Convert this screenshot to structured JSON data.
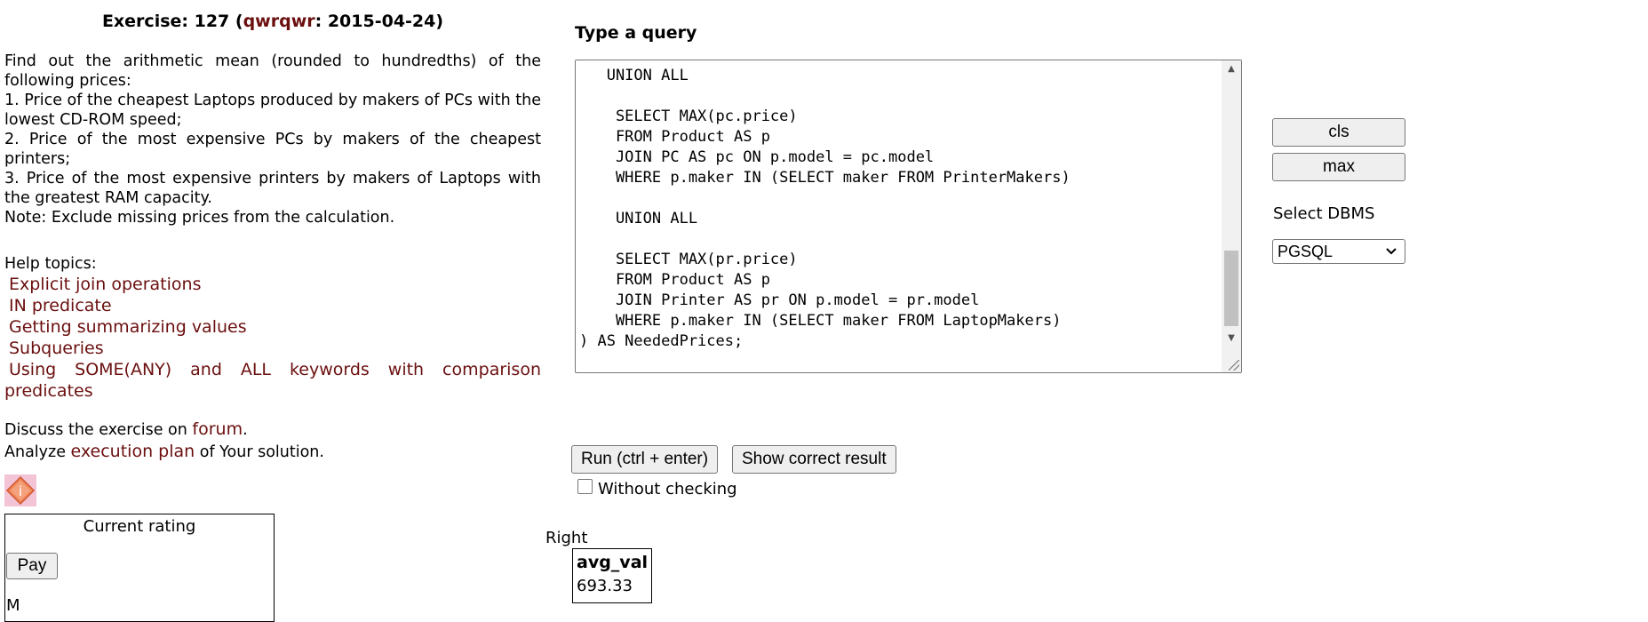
{
  "exercise": {
    "prefix": "Exercise: 127 (",
    "author": "qwrqwr",
    "suffix": ": 2015-04-24)"
  },
  "task_lines": [
    "Find out the arithmetic mean (rounded to hundredths) of the following prices:",
    "1. Price of the cheapest Laptops produced by makers of PCs with the lowest CD-ROM speed;",
    "2. Price of the most expensive PCs by makers of the cheapest printers;",
    "3. Price of the most expensive printers by makers of Laptops with the greatest RAM capacity.",
    "Note: Exclude missing prices from the calculation."
  ],
  "help": {
    "label": "Help topics:",
    "links": [
      "Explicit join operations",
      "IN predicate",
      "Getting summarizing values",
      "Subqueries",
      "Using SOME(ANY) and ALL keywords with comparison predicates"
    ]
  },
  "discuss": {
    "pre": "Discuss the exercise on ",
    "link": "forum",
    "post": "."
  },
  "analyze": {
    "pre": "Analyze ",
    "link": "execution plan",
    "post": " of Your solution."
  },
  "rating": {
    "title": "Current rating",
    "pay_label": "Pay",
    "partial_text": "M"
  },
  "query": {
    "label": "Type a query",
    "text": "   UNION ALL\n\n    SELECT MAX(pc.price)\n    FROM Product AS p\n    JOIN PC AS pc ON p.model = pc.model\n    WHERE p.maker IN (SELECT maker FROM PrinterMakers)\n\n    UNION ALL\n\n    SELECT MAX(pr.price)\n    FROM Product AS p\n    JOIN Printer AS pr ON p.model = pr.model\n    WHERE p.maker IN (SELECT maker FROM LaptopMakers)\n) AS NeededPrices;"
  },
  "controls": {
    "cls_label": "cls",
    "max_label": "max",
    "dbms_label": "Select DBMS",
    "dbms_selected": "PGSQL",
    "run_label": "Run (ctrl + enter)",
    "show_result_label": "Show correct result",
    "without_checking_label": "Without checking"
  },
  "result": {
    "status": "Right",
    "column": "avg_val",
    "value": "693.33"
  }
}
